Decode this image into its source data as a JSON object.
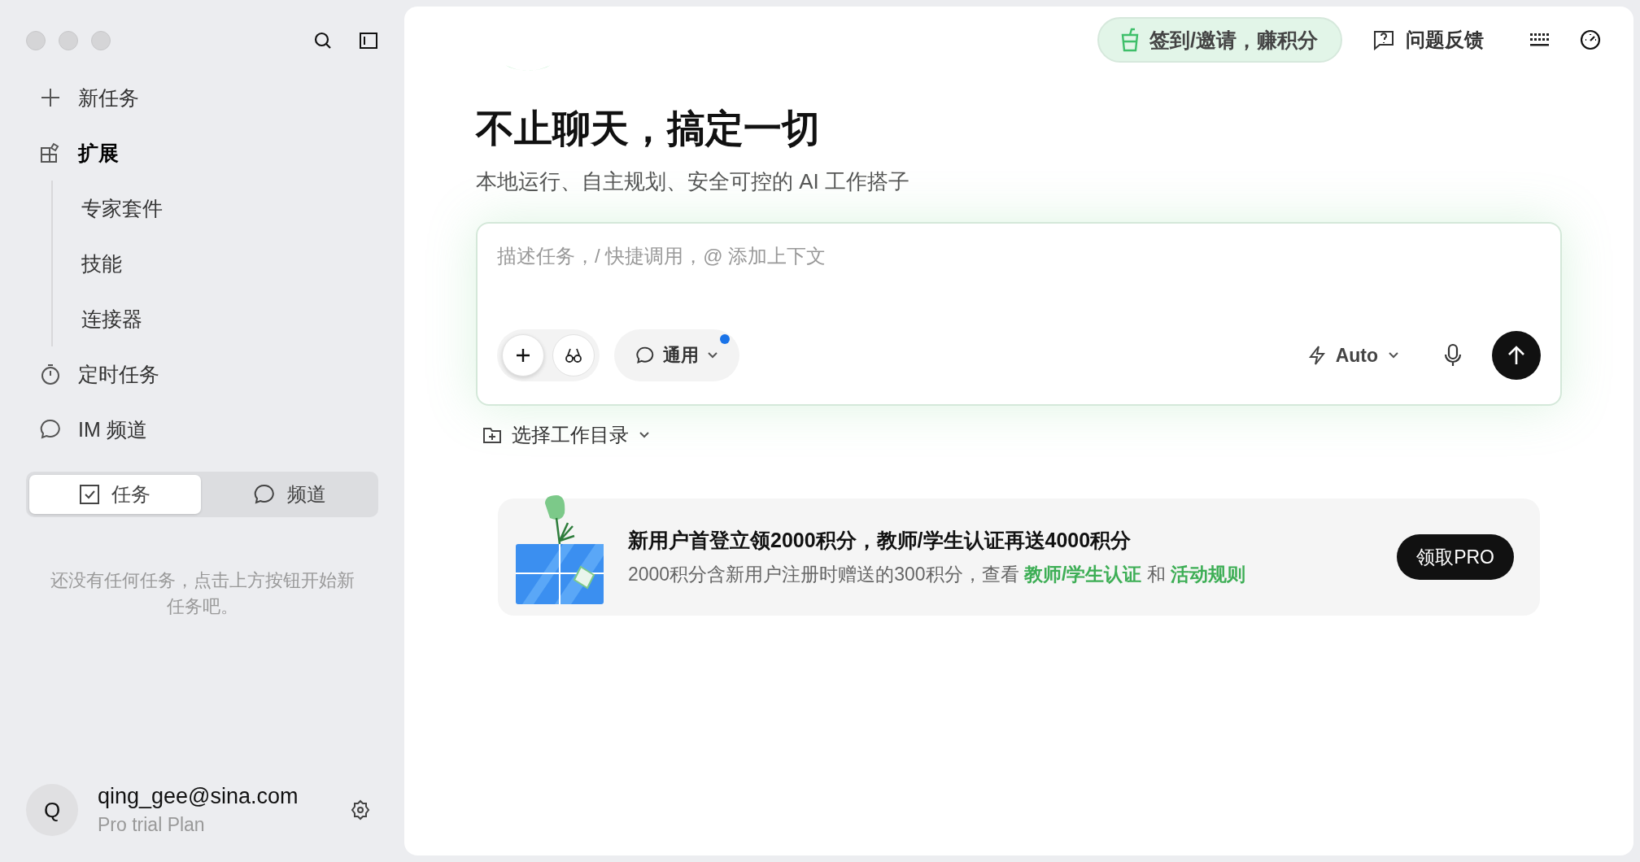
{
  "sidebar": {
    "nav": [
      {
        "kind": "plus",
        "label": "新任务",
        "selected": false
      },
      {
        "kind": "extension",
        "label": "扩展",
        "selected": true,
        "children": [
          {
            "label": "专家套件"
          },
          {
            "label": "技能"
          },
          {
            "label": "连接器"
          }
        ]
      },
      {
        "kind": "timer",
        "label": "定时任务",
        "selected": false
      },
      {
        "kind": "chat",
        "label": "IM 频道",
        "selected": false
      }
    ],
    "tabs": [
      {
        "kind": "check",
        "label": "任务",
        "selected": true
      },
      {
        "kind": "chat",
        "label": "频道",
        "selected": false
      }
    ],
    "empty_text": "还没有任何任务，点击上方按钮开始新任务吧。",
    "account": {
      "avatar": "Q",
      "email": "qing_gee@sina.com",
      "plan": "Pro trial Plan"
    }
  },
  "topbar": {
    "rewards_button": "签到/邀请，赚积分",
    "feedback_button": "问题反馈"
  },
  "hero": {
    "title": "不止聊天，搞定一切",
    "subtitle": "本地运行、自主规划、安全可控的 AI 工作搭子"
  },
  "composer": {
    "placeholder": "描述任务，/ 快捷调用，@ 添加上下文",
    "mode": "通用",
    "mode_unread": true,
    "model": "Auto"
  },
  "workdir": "选择工作目录",
  "banner": {
    "title": "新用户首登立领2000积分，教师/学生认证再送4000积分",
    "note": [
      {
        "kind": "text",
        "text": "2000积分含新用户注册时赠送的300积分，查看 "
      },
      {
        "kind": "link",
        "text": "教师/学生认证"
      },
      {
        "kind": "text",
        "text": " 和 "
      },
      {
        "kind": "link",
        "text": "活动规则"
      }
    ],
    "button": "领取PRO"
  }
}
